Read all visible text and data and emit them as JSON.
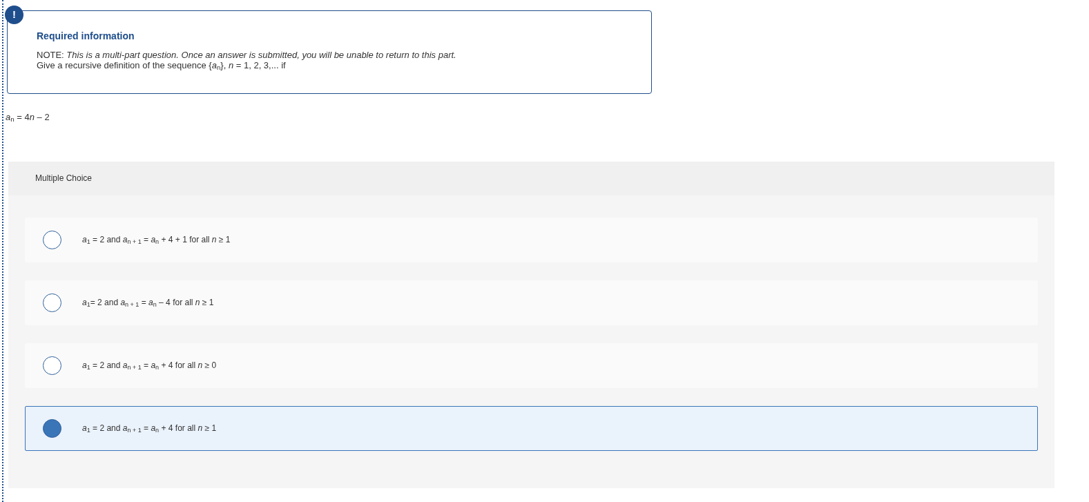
{
  "alert": {
    "badge": "!",
    "title": "Required information",
    "note_label": "NOTE:",
    "note": "This is a multi-part question. Once an answer is submitted, you will be unable to return to this part.",
    "prompt": "Give a recursive definition of the sequence {*a*$_{n}$}, *n* = 1, 2, 3,... if"
  },
  "equation": {
    "left": "*a*$_{n}$ = 4",
    "variable": "n",
    "right": " – 2"
  },
  "question": {
    "type_label": "Multiple Choice",
    "options": [
      {
        "text": "*a*$_{1}$ = 2 and *a*$_{n + 1}$ = *a*$_{n}$ + 4 + 1 for all *n* ≥ 1",
        "selected": false
      },
      {
        "text": "*a*$_{1}$= 2 and *a*$_{n + 1}$ = *a*$_{n}$ – 4 for all *n* ≥ 1",
        "selected": false
      },
      {
        "text": "*a*$_{1}$ = 2 and *a*$_{n + 1}$ = *a*$_{n}$ + 4 for all *n* ≥ 0",
        "selected": false
      },
      {
        "text": "*a*$_{1}$ = 2 and *a*$_{n + 1}$ = *a*$_{n}$ + 4 for all *n* ≥ 1",
        "selected": true
      }
    ]
  }
}
